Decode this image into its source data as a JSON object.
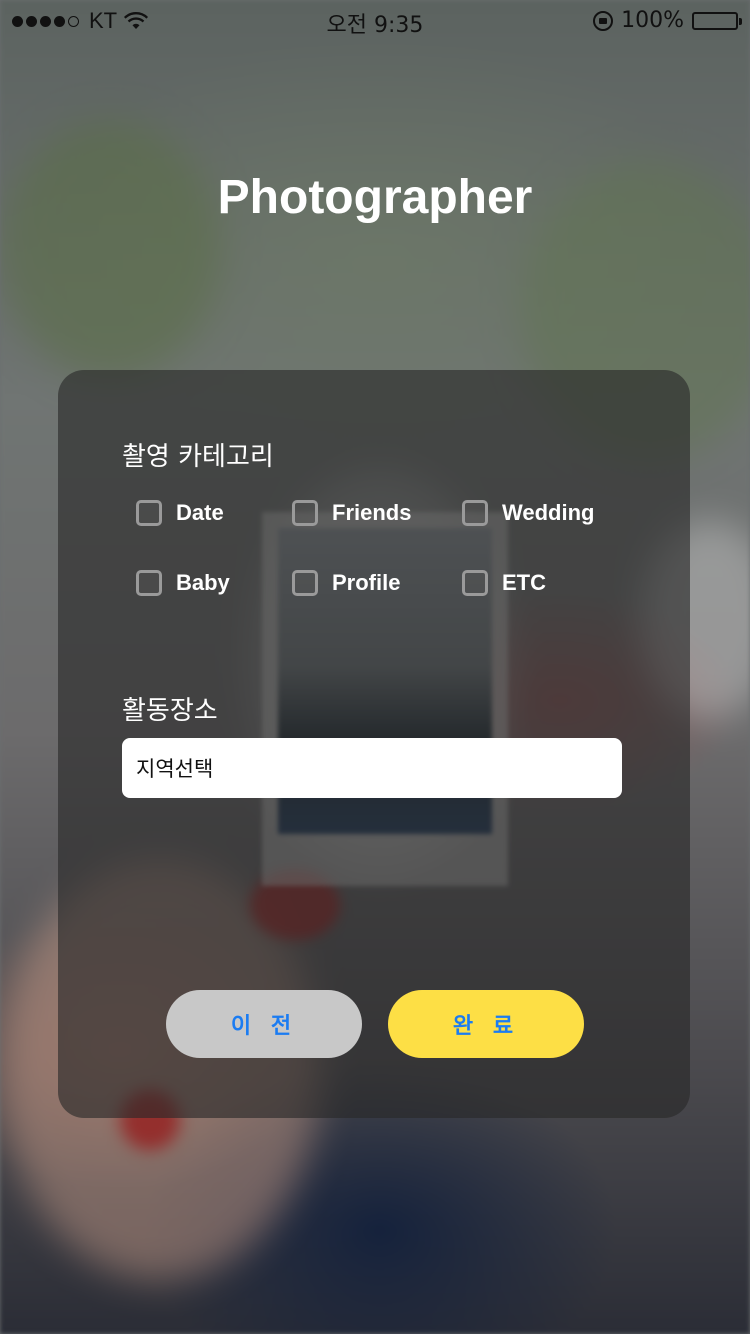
{
  "status_bar": {
    "carrier": "KT",
    "time": "오전 9:35",
    "battery": "100%",
    "signal_dots_filled": 4,
    "signal_dots_total": 5
  },
  "title": "Photographer",
  "form": {
    "category_label": "촬영 카테고리",
    "categories": [
      {
        "label": "Date",
        "checked": false
      },
      {
        "label": "Friends",
        "checked": false
      },
      {
        "label": "Wedding",
        "checked": false
      },
      {
        "label": "Baby",
        "checked": false
      },
      {
        "label": "Profile",
        "checked": false
      },
      {
        "label": "ETC",
        "checked": false
      }
    ],
    "location_label": "활동장소",
    "location_value": "지역선택"
  },
  "buttons": {
    "prev_label": "이 전",
    "done_label": "완 료"
  },
  "colors": {
    "done_button": "#fddf45",
    "prev_button": "#c8c8c8",
    "button_text": "#1b7cf2"
  }
}
